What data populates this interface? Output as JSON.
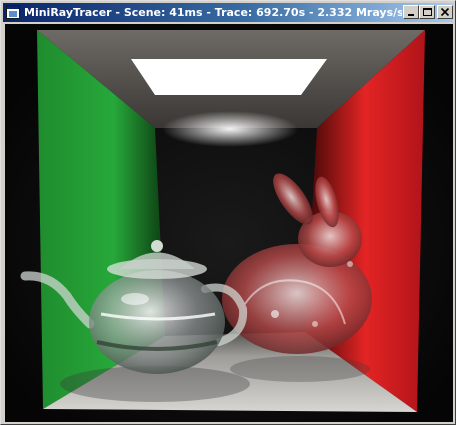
{
  "window": {
    "title": "MiniRayTracer - Scene: 41ms - Trace: 692.70s - 2.332 Mrays/s |",
    "app_icon": "app-window-icon",
    "controls": {
      "minimize_icon": "minimize-icon",
      "maximize_icon": "maximize-icon",
      "close_icon": "close-icon"
    }
  },
  "render": {
    "scene": "cornell-box",
    "objects": [
      "ceiling-light",
      "glass-teapot",
      "glass-bunny"
    ],
    "colors": {
      "left_wall": "#2a9e3a",
      "right_wall": "#d41e1e",
      "back_wall": "#0a0a0a",
      "floor": "#c8c8c8",
      "ceiling_light": "#ffffff"
    }
  }
}
